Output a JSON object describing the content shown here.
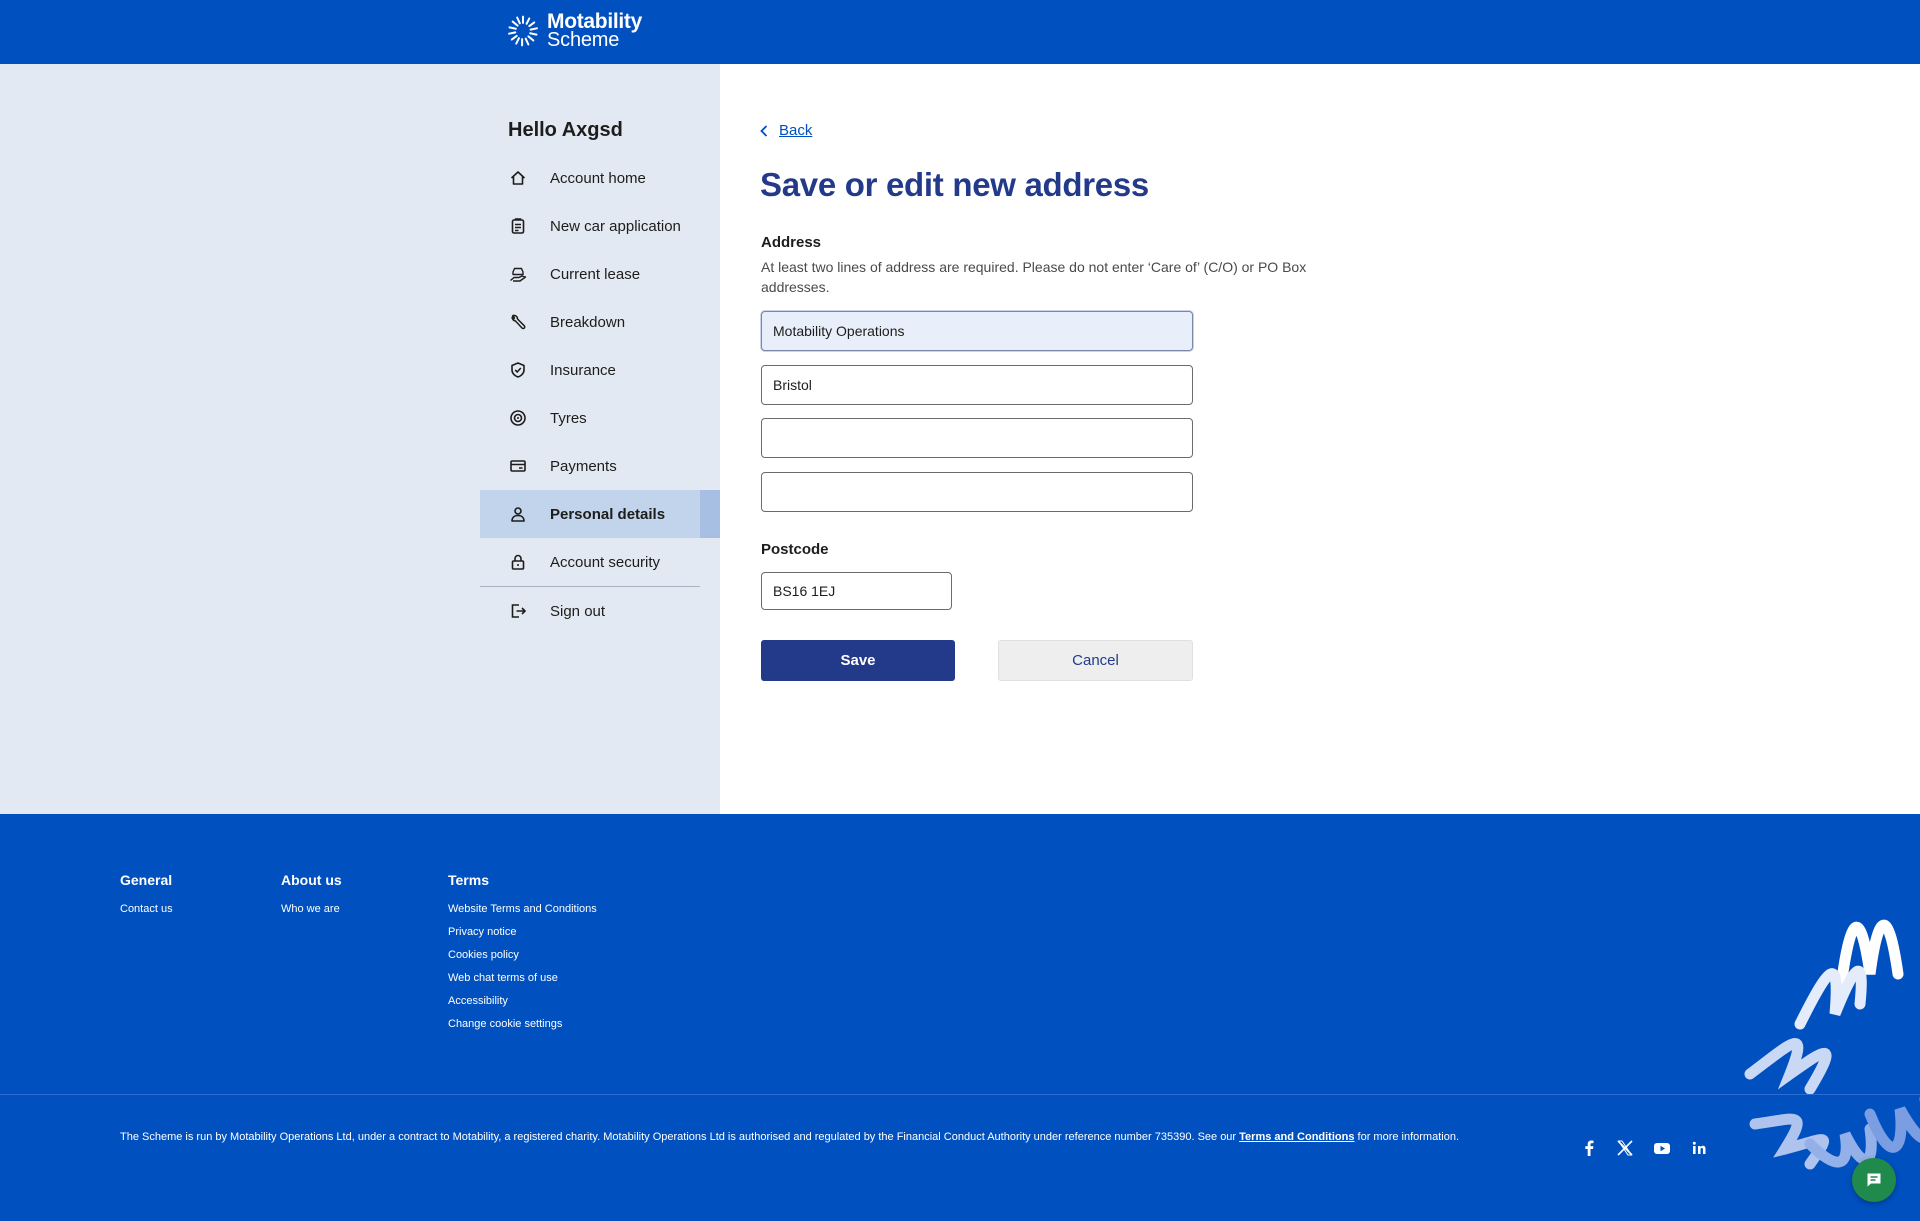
{
  "header": {
    "logo_line1": "Motability",
    "logo_line2": "Scheme"
  },
  "sidebar": {
    "greeting": "Hello Axgsd",
    "items": [
      {
        "label": "Account home",
        "icon": "home-icon"
      },
      {
        "label": "New car application",
        "icon": "clipboard-icon"
      },
      {
        "label": "Current lease",
        "icon": "car-hand-icon"
      },
      {
        "label": "Breakdown",
        "icon": "wrench-icon"
      },
      {
        "label": "Insurance",
        "icon": "shield-check-icon"
      },
      {
        "label": "Tyres",
        "icon": "tyre-icon"
      },
      {
        "label": "Payments",
        "icon": "card-icon"
      },
      {
        "label": "Personal details",
        "icon": "person-icon",
        "active": true
      },
      {
        "label": "Account security",
        "icon": "lock-icon"
      }
    ],
    "signout": {
      "label": "Sign out",
      "icon": "sign-out-icon"
    }
  },
  "main": {
    "back_label": "Back",
    "title": "Save or edit new address",
    "address_label": "Address",
    "address_hint": "At least two lines of address are required. Please do not enter ‘Care of’ (C/O) or PO Box addresses.",
    "address_lines": [
      "Motability Operations",
      "Bristol",
      "",
      ""
    ],
    "postcode_label": "Postcode",
    "postcode_value": "BS16 1EJ",
    "save_label": "Save",
    "cancel_label": "Cancel"
  },
  "footer": {
    "columns": [
      {
        "heading": "General",
        "links": [
          "Contact us"
        ]
      },
      {
        "heading": "About us",
        "links": [
          "Who we are"
        ]
      },
      {
        "heading": "Terms",
        "links": [
          "Website Terms and Conditions",
          "Privacy notice",
          "Cookies policy",
          "Web chat terms of use",
          "Accessibility",
          "Change cookie settings"
        ]
      }
    ],
    "legal_text": "The Scheme is run by Motability Operations Ltd, under a contract to Motability, a registered charity. Motability Operations Ltd is authorised and regulated by the Financial Conduct Authority under reference number 735390. See our ",
    "legal_link": "Terms and Conditions",
    "legal_suffix": " for more information.",
    "social": [
      "facebook-icon",
      "x-icon",
      "youtube-icon",
      "linkedin-icon"
    ]
  },
  "colors": {
    "brand_blue": "#0050c0",
    "navy": "#233a8a",
    "sidebar_bg": "#e3e9f2",
    "active_item": "#c2d3ec",
    "chat_green": "#1f8a4c"
  }
}
